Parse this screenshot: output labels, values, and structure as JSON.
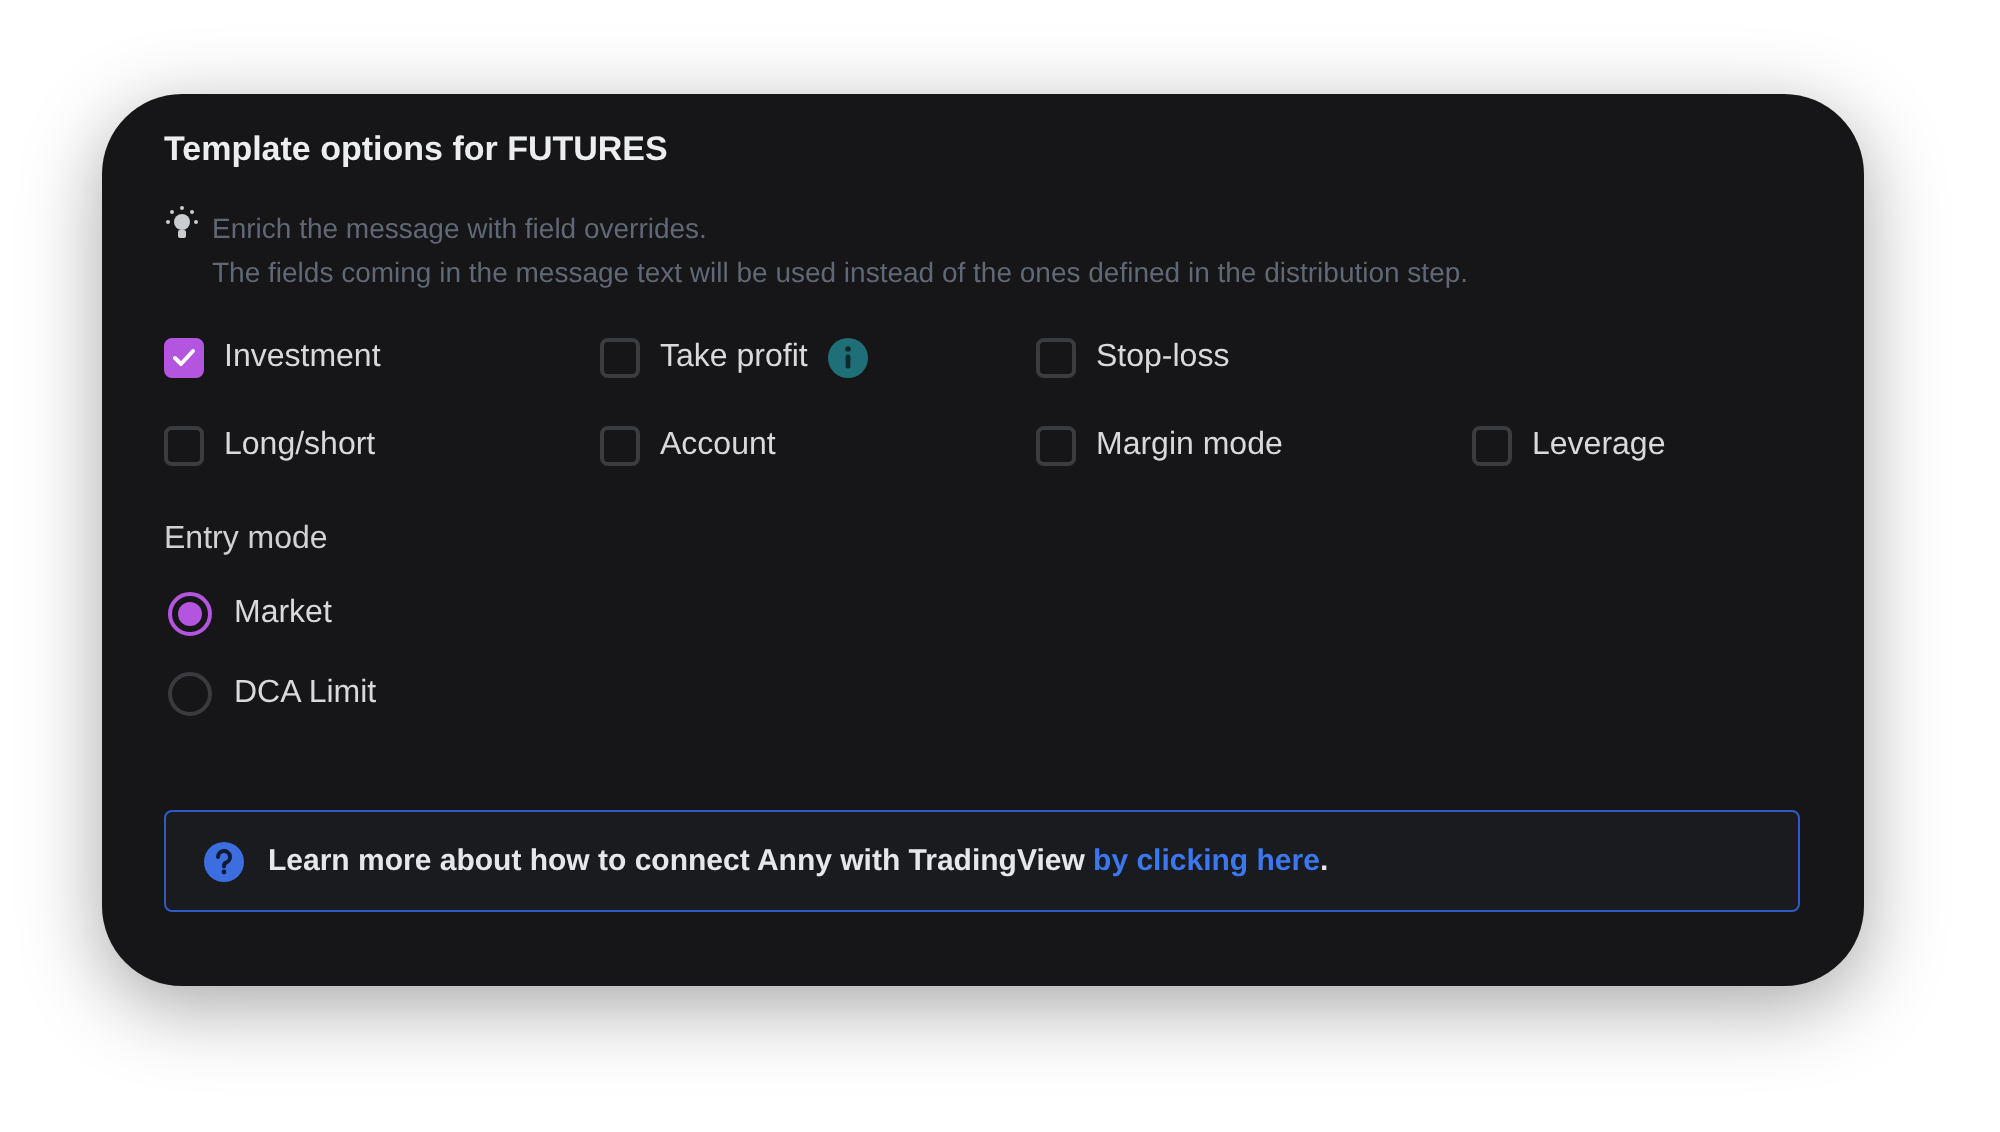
{
  "panel": {
    "title": "Template options for FUTURES",
    "hint": [
      "Enrich the message with field overrides.",
      "The fields coming in the message text will be used instead of the ones defined in the distribution step."
    ],
    "field_rows": [
      [
        {
          "label": "Investment",
          "checked": true,
          "info": false
        },
        {
          "label": "Take profit",
          "checked": false,
          "info": true
        },
        {
          "label": "Stop-loss",
          "checked": false,
          "info": false
        }
      ],
      [
        {
          "label": "Long/short",
          "checked": false,
          "info": false
        },
        {
          "label": "Account",
          "checked": false,
          "info": false
        },
        {
          "label": "Margin mode",
          "checked": false,
          "info": false
        },
        {
          "label": "Leverage",
          "checked": false,
          "info": false
        }
      ]
    ],
    "entry_mode": {
      "label": "Entry mode",
      "options": [
        {
          "label": "Market",
          "selected": true
        },
        {
          "label": "DCA Limit",
          "selected": false
        }
      ]
    },
    "note": {
      "text": "Learn more about how to connect Anny with TradingView ",
      "link": "by clicking here",
      "after": "."
    }
  }
}
